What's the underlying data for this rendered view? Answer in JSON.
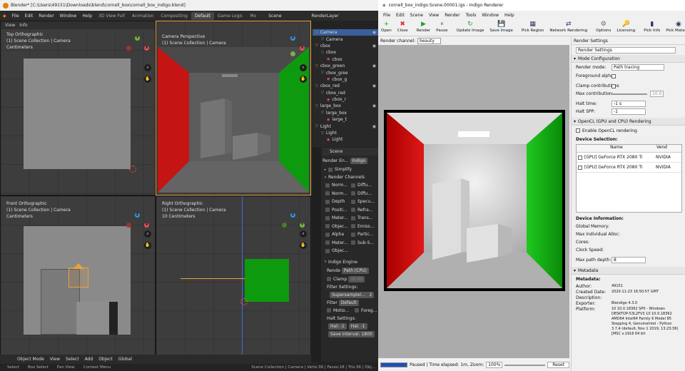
{
  "blender": {
    "title": "Blender* [C:\\Users\\49151\\Downloads\\blend\\cornell_box\\cornell_box_indigo.blend]",
    "menu": [
      "File",
      "Edit",
      "Render",
      "Window",
      "Help"
    ],
    "workspaces": [
      "3D View Full",
      "Animation",
      "Compositing",
      "Default",
      "Game Logic",
      "Mo"
    ],
    "scene": "Scene",
    "renderlayer": "RenderLayer",
    "vp_menu": [
      "View",
      "Info"
    ],
    "views": [
      {
        "title": "Top Orthographic",
        "sub": "(1) Scene Collection | Camera",
        "unit": "Centimeters"
      },
      {
        "title": "Camera Perspective",
        "sub": "(1) Scene Collection | Camera",
        "unit": ""
      },
      {
        "title": "Front Orthographic",
        "sub": "(1) Scene Collection | Camera",
        "unit": "Centimeters"
      },
      {
        "title": "Right Orthographic",
        "sub": "(1) Scene Collection | Camera",
        "unit": "10 Centimeters"
      }
    ],
    "outliner": [
      {
        "name": "Camera",
        "lvl": 0
      },
      {
        "name": "Camera",
        "lvl": 1
      },
      {
        "name": "cbox",
        "lvl": 0
      },
      {
        "name": "cbox",
        "lvl": 1
      },
      {
        "name": "cbox",
        "lvl": 2
      },
      {
        "name": "cbox_green",
        "lvl": 0
      },
      {
        "name": "cbox_gree",
        "lvl": 1
      },
      {
        "name": "cbox_g",
        "lvl": 2
      },
      {
        "name": "cbox_red",
        "lvl": 0
      },
      {
        "name": "cbox_red",
        "lvl": 1
      },
      {
        "name": "cbox_r",
        "lvl": 2
      },
      {
        "name": "large_box",
        "lvl": 0
      },
      {
        "name": "large_box",
        "lvl": 1
      },
      {
        "name": "large_t",
        "lvl": 2
      },
      {
        "name": "Light",
        "lvl": 0
      },
      {
        "name": "Light",
        "lvl": 1
      },
      {
        "name": "Light",
        "lvl": 2
      }
    ],
    "props_scene": "Scene",
    "render_engine_lbl": "Render En...",
    "render_engine": "Indigo",
    "simplify": "Simplify",
    "render_channels": "Render Channels",
    "channels": [
      [
        "Norm...",
        "Diffu..."
      ],
      [
        "Norm...",
        "Diffu..."
      ],
      [
        "Depth",
        "Specu..."
      ],
      [
        "Positi...",
        "Refra..."
      ],
      [
        "Mater...",
        "Trans..."
      ],
      [
        "Objec...",
        "Emiss..."
      ],
      [
        "Alpha",
        "Partic..."
      ],
      [
        "Mater...",
        "Sub-S..."
      ],
      [
        "Objec...",
        ""
      ]
    ],
    "indigo_engine": "Indigo Engine",
    "render_lbl": "Rende",
    "render_mode": "Path (CPU)",
    "clamp": "Clamp",
    "clamp_val": "10.00",
    "filter_settings": "Filter Settings:",
    "supersample": "Supersamplel...",
    "supersample_val": "2",
    "filter_lbl": "Filter",
    "filter": "Default",
    "motion": "Motio...",
    "foreg": "Foreg...",
    "halt_settings": "Halt Settings:",
    "halt1": "Hal: -1",
    "halt2": "Hal: -1",
    "save_interval": "Save interval: 1800",
    "bottom": [
      "Object Mode",
      "View",
      "Select",
      "Add",
      "Object",
      "Global"
    ],
    "status": [
      "Select",
      "Box Select",
      "Pan View",
      "Context Menu"
    ],
    "status_right": "Scene Collection | Camera | Verts:36 | Faces:18 | Tris:36 | Obj..."
  },
  "indigo": {
    "title": "cornell_box_indigo.Scene.00001.igs - Indigo Renderer",
    "menu": [
      "File",
      "Edit",
      "Scene",
      "View",
      "Render",
      "Tools",
      "Window",
      "Help"
    ],
    "tools": [
      {
        "icon": "+",
        "label": "Open",
        "c": "#2a9d2a"
      },
      {
        "icon": "✖",
        "label": "Close",
        "c": "#d33"
      },
      {
        "icon": "▶",
        "label": "Render",
        "c": "#2a9d2a"
      },
      {
        "icon": "⏸",
        "label": "Pause",
        "c": "#888"
      },
      {
        "icon": "↻",
        "label": "Update Image",
        "c": "#2a9d2a"
      },
      {
        "icon": "💾",
        "label": "Save Image",
        "c": "#336"
      },
      {
        "icon": "▦",
        "label": "Pick Region",
        "c": "#336"
      },
      {
        "icon": "⇄",
        "label": "Network Rendering",
        "c": "#336"
      },
      {
        "icon": "⚙",
        "label": "Options",
        "c": "#666"
      },
      {
        "icon": "🔑",
        "label": "Licensing",
        "c": "#c90"
      },
      {
        "icon": "▮",
        "label": "Pick Info",
        "c": "#336"
      },
      {
        "icon": "◉",
        "label": "Pick Material",
        "c": "#336"
      }
    ],
    "render_channel_lbl": "Render channel:",
    "render_channel": "beauty",
    "status_text": "Paused | Time elapsed: 1m,   Zoom:",
    "zoom": "100%",
    "reset": "Reset",
    "panel_title": "Render Settings",
    "settings_select": "Render Settings",
    "mode_cfg": "Mode Configuration",
    "render_mode_lbl": "Render mode:",
    "render_mode": "Path tracing",
    "fg_alpha": "Foreground alpha",
    "clamp_contrib": "Clamp contributions",
    "max_contrib": "Max contribution:",
    "max_contrib_val": "10.0",
    "halt_time": "Halt time:",
    "halt_time_val": "-1 s",
    "halt_spp": "Halt SPP:",
    "halt_spp_val": "-1",
    "opencl": "OpenCL (GPU and CPU) Rendering",
    "enable_opencl": "Enable OpenCL rendering",
    "dev_sel": "Device Selection:",
    "col_name": "Name",
    "col_vendor": "Vend",
    "devices": [
      {
        "name": "[GPU] GeForce RTX 2080 Ti",
        "vendor": "NVIDIA"
      },
      {
        "name": "[GPU] GeForce RTX 2080 Ti",
        "vendor": "NVIDIA"
      }
    ],
    "dev_info": "Device Information:",
    "global_mem": "Global Memory:",
    "max_alloc": "Max Individual Alloc:",
    "cores": "Cores:",
    "clock": "Clock Speed:",
    "max_depth": "Max path depth:",
    "max_depth_val": "8",
    "metadata": "Metadata",
    "metadata_h": "Metadata:",
    "meta": [
      [
        "Author:",
        "49151"
      ],
      [
        "Created Date:",
        "2020-11-23 16:50:57 GMT"
      ],
      [
        "Description:",
        ""
      ],
      [
        "Exporter:",
        "Blendigo 4.3.0"
      ],
      [
        "Platform:",
        "10 10.0.18362 SP0 - Windows DESKTOP-53L2FV3 10 10.0.18362 AMD64 Intel64 Family 6 Model 85 Stepping 4, GenuineIntel - Python 3.7.4 (default, Nov 1 2019, 13:23:36) [MSC v.1916 64 bit"
      ]
    ]
  },
  "colors": {
    "red": "#c41414",
    "green": "#0e9a0e",
    "blender_orange": "#e87d0d"
  }
}
